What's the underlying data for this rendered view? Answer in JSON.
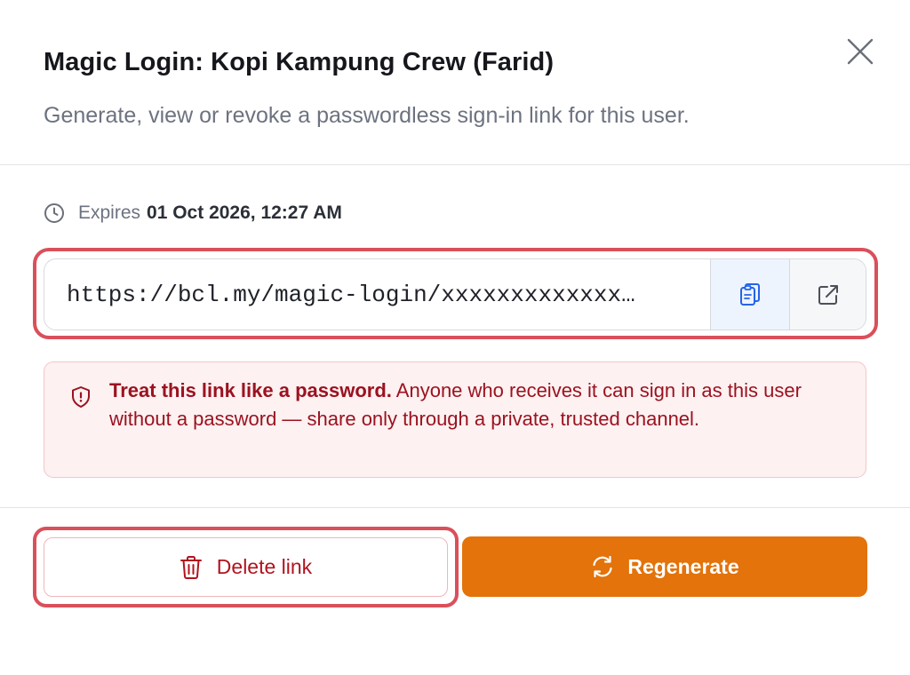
{
  "dialog": {
    "title": "Magic Login: Kopi Kampung Crew (Farid)",
    "subtitle": "Generate, view or revoke a passwordless sign-in link for this user.",
    "close_icon": "close-icon"
  },
  "expiry": {
    "icon": "clock-icon",
    "label": "Expires",
    "value": "01 Oct 2026, 12:27 AM"
  },
  "link": {
    "url": "https://bcl.my/magic-login/xxxxxxxxxxxxx…",
    "copy_icon": "copy-icon",
    "open_icon": "external-link-icon"
  },
  "warning": {
    "icon": "shield-icon",
    "strong": "Treat this link like a password.",
    "text": " Anyone who receives it can sign in as this user without a password — share only through a private, trusted channel."
  },
  "actions": {
    "delete_label": "Delete link",
    "delete_icon": "trash-icon",
    "regenerate_label": "Regenerate",
    "regenerate_icon": "refresh-icon"
  },
  "colors": {
    "accent": "#e3730a",
    "danger": "#b1131f",
    "highlight": "#d9505b",
    "warning_bg": "#fdf1f1"
  }
}
